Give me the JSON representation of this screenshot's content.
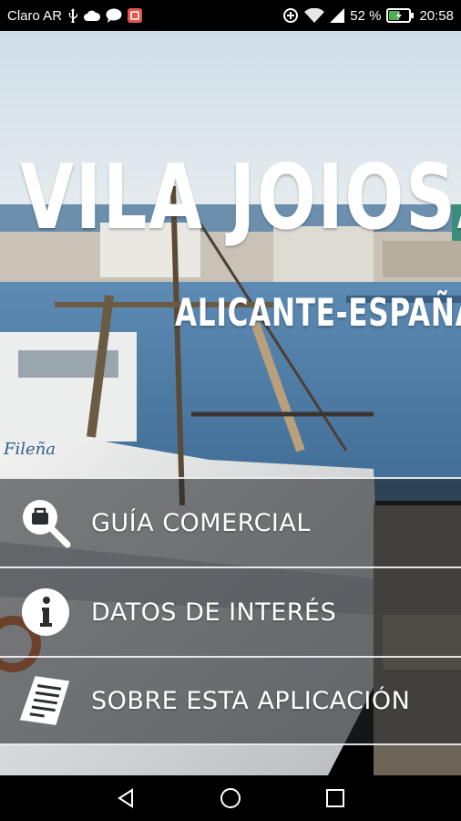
{
  "status_bar": {
    "carrier": "Claro AR",
    "battery_percent": "52 %",
    "time": "20:58",
    "battery_level": 0.52,
    "icons": [
      "usb-icon",
      "cloud-icon",
      "chat-icon",
      "notification-app-icon",
      "data-saver-icon",
      "wifi-icon",
      "cellular-signal-icon",
      "battery-icon"
    ]
  },
  "hero": {
    "title": "VILA JOIOSA",
    "subtitle": "ALICANTE-ESPAÑA"
  },
  "menu": {
    "items": [
      {
        "label": "GUÍA COMERCIAL",
        "icon": "search-bag-icon"
      },
      {
        "label": "DATOS DE INTERÉS",
        "icon": "info-icon"
      },
      {
        "label": "SOBRE ESTA APLICACIÓN",
        "icon": "document-icon"
      }
    ]
  },
  "boat": {
    "name": "Fileña"
  },
  "nav_bar": {
    "buttons": [
      "back-icon",
      "home-icon",
      "recents-icon"
    ]
  },
  "colors": {
    "status_bar_bg": "#000000",
    "menu_overlay": "#23262a",
    "sky": "#dfe8ee",
    "sea": "#4f7da6"
  }
}
